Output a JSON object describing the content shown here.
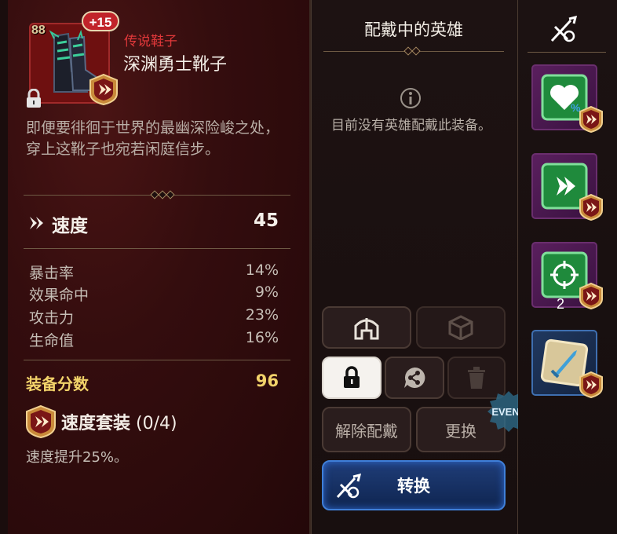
{
  "item": {
    "level": "88",
    "enhance": "+15",
    "rarity": "传说鞋子",
    "name": "深渊勇士靴子",
    "description": "即便要徘徊于世界的最幽深险峻之处，穿上这靴子也宛若闲庭信步。",
    "main_stat": {
      "label": "速度",
      "value": "45"
    },
    "sub_stats": [
      {
        "label": "暴击率",
        "value": "14%"
      },
      {
        "label": "效果命中",
        "value": "9%"
      },
      {
        "label": "攻击力",
        "value": "23%"
      },
      {
        "label": "生命值",
        "value": "16%"
      }
    ],
    "score_label": "装备分数",
    "score_value": "96",
    "set": {
      "name": "速度套装",
      "count": "(0/4)",
      "effect": "速度提升25%。"
    }
  },
  "equipped": {
    "title": "配戴中的英雄",
    "empty_message": "目前没有英雄配戴此装备。"
  },
  "buttons": {
    "unequip": "解除配戴",
    "replace": "更换",
    "convert": "转换",
    "event": "EVENT"
  },
  "side_slots": [
    {
      "icon": "heart-percent-icon",
      "count": ""
    },
    {
      "icon": "speed-arrow-icon",
      "count": ""
    },
    {
      "icon": "crosshair-icon",
      "count": "2"
    },
    {
      "icon": "blue-sword-icon",
      "count": ""
    }
  ],
  "colors": {
    "rarity": "#e0383a",
    "score": "#f2d36a",
    "primary_button": "#1f3d78",
    "set_badge": "#c98a3a"
  }
}
